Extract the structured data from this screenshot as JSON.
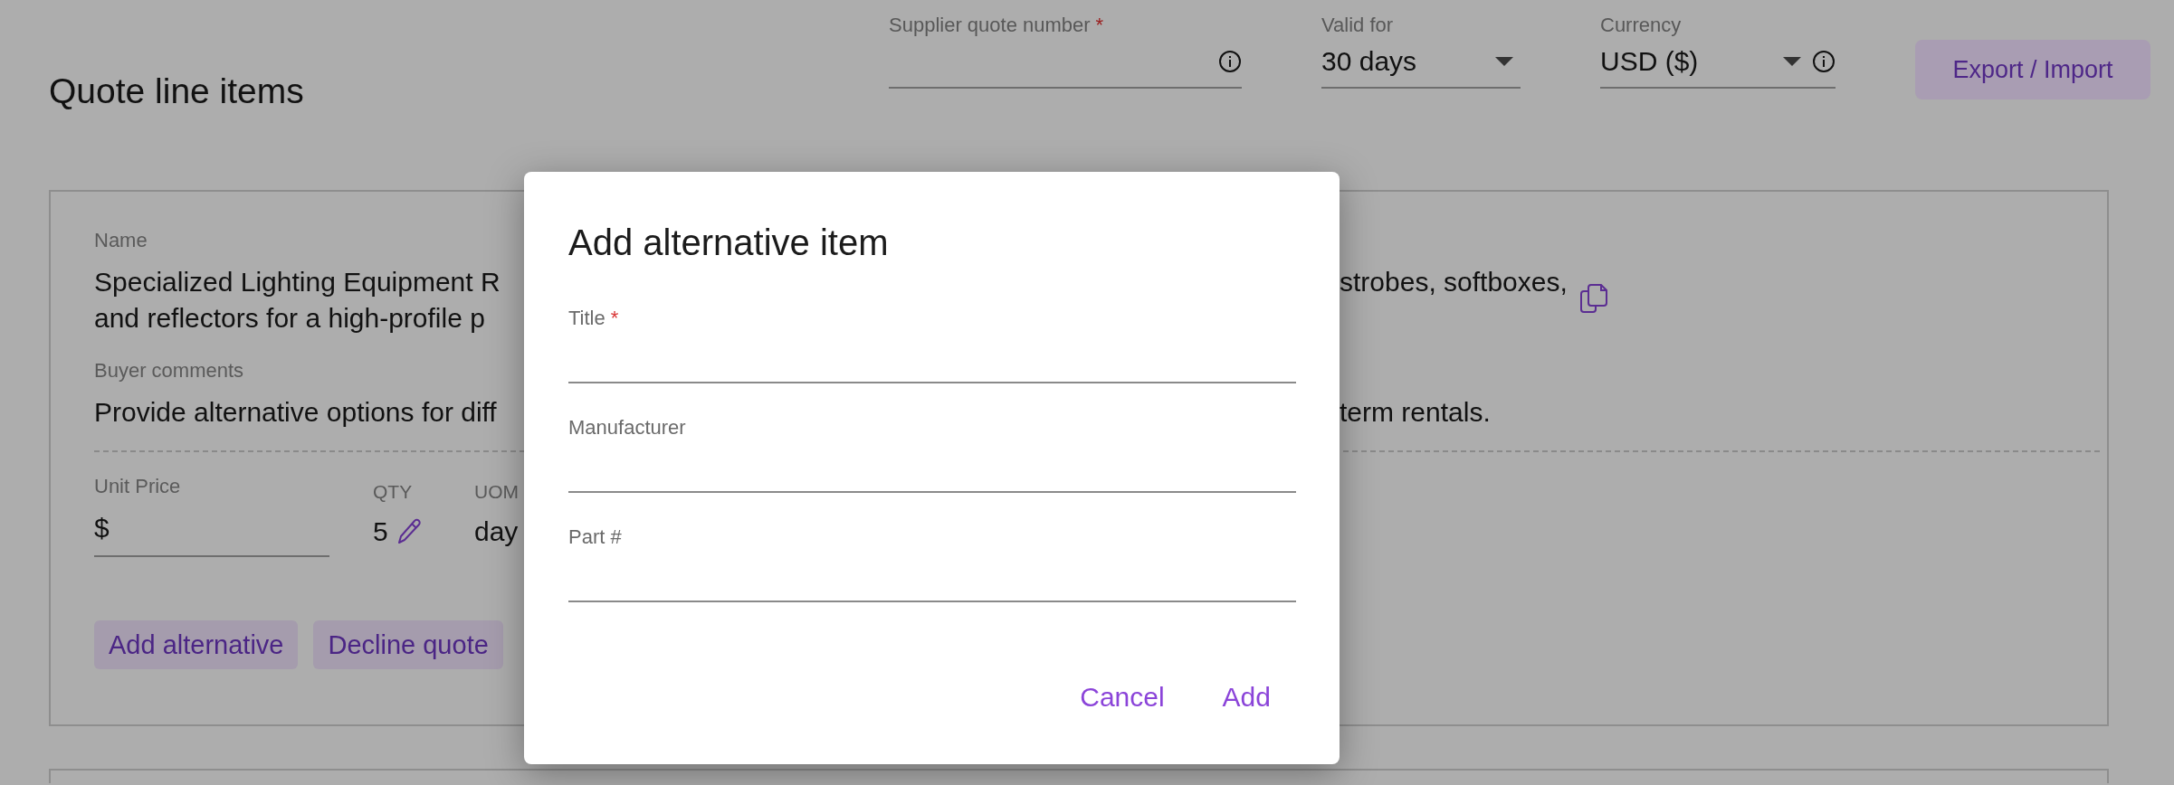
{
  "page": {
    "title": "Quote line items"
  },
  "header_fields": [
    {
      "kind": "input",
      "label": "Supplier quote number",
      "required_mark": "*",
      "info": true
    },
    {
      "kind": "select",
      "label": "Valid for",
      "value": "30 days",
      "info": false
    },
    {
      "kind": "select",
      "label": "Currency",
      "value": "USD ($)",
      "info": true
    }
  ],
  "header_button": "Export / Import",
  "line_item": {
    "name_label": "Name",
    "name_left": [
      "Specialized Lighting Equipment R",
      "and reflectors for a high-profile p"
    ],
    "name_right": "strobes, softboxes,",
    "comments_label": "Buyer comments",
    "comments_left": "Provide alternative options for diff",
    "comments_right": "term rentals.",
    "unit_price_label": "Unit Price",
    "currency_symbol": "$",
    "qty_label": "QTY",
    "qty": "5",
    "uom_label": "UOM",
    "uom": "day",
    "buttons": [
      "Add alternative",
      "Decline quote"
    ]
  },
  "dialog": {
    "title": "Add alternative item",
    "fields": [
      {
        "label": "Title",
        "required_mark": "*"
      },
      {
        "label": "Manufacturer"
      },
      {
        "label": "Part #"
      }
    ],
    "actions": [
      "Cancel",
      "Add"
    ]
  }
}
